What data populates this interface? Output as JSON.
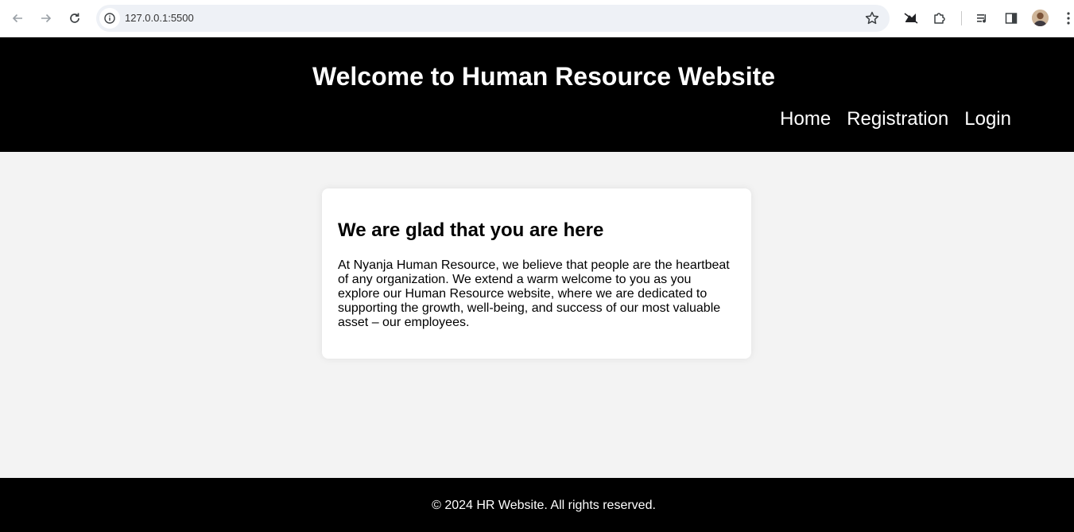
{
  "browser": {
    "url": "127.0.0.1:5500",
    "icons": [
      "back-arrow-icon",
      "forward-arrow-icon",
      "reload-icon",
      "site-info-icon",
      "bookmark-star-icon",
      "extension-icon",
      "puzzle-icon",
      "media-control-icon",
      "side-panel-icon",
      "profile-avatar",
      "more-menu-icon"
    ]
  },
  "header": {
    "title": "Welcome to Human Resource Website",
    "nav": [
      {
        "label": "Home"
      },
      {
        "label": "Registration"
      },
      {
        "label": "Login"
      }
    ]
  },
  "card": {
    "heading": "We are glad that you are here",
    "body": "At Nyanja Human Resource, we believe that people are the heartbeat of any organization. We extend a warm welcome to you as you explore our Human Resource website, where we are dedicated to supporting the growth, well-being, and success of our most valuable asset – our employees."
  },
  "footer": {
    "text": "© 2024 HR Website. All rights reserved."
  },
  "colors": {
    "header_bg": "#000000",
    "footer_bg": "#000000",
    "page_bg": "#f3f3f3",
    "card_bg": "#ffffff"
  }
}
